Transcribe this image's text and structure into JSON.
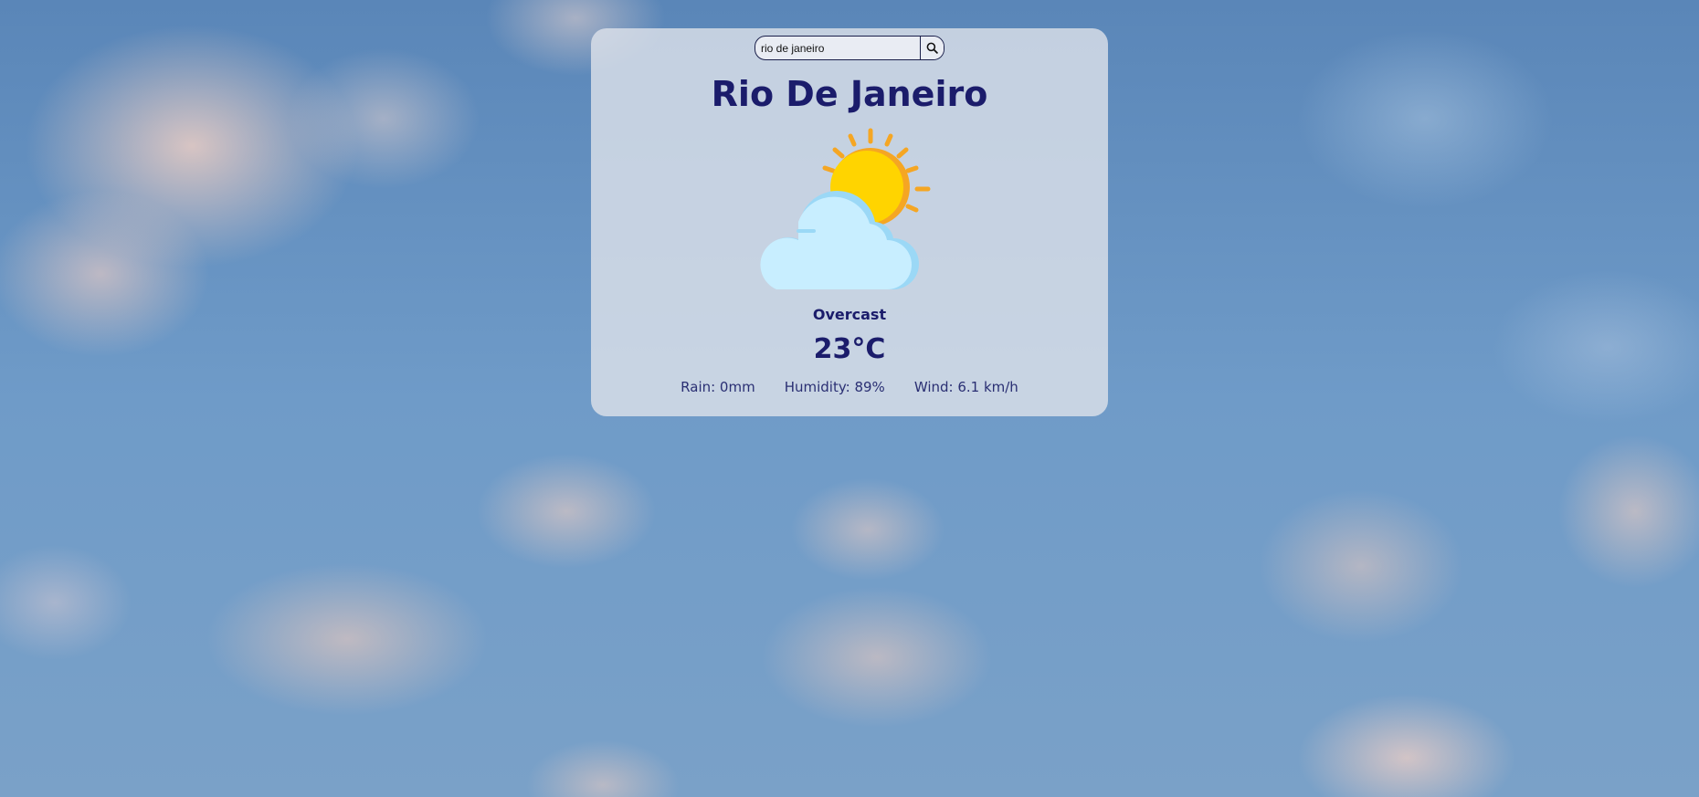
{
  "search": {
    "value": "rio de janeiro",
    "icon": "search-icon"
  },
  "weather": {
    "city": "Rio De Janeiro",
    "icon": "partly-cloudy-icon",
    "condition": "Overcast",
    "temperature": "23°C",
    "stats": {
      "rain": "Rain: 0mm",
      "humidity": "Humidity: 89%",
      "wind": "Wind: 6.1 km/h"
    }
  },
  "colors": {
    "text_primary": "#1b1c6b",
    "card_background": "rgba(220,225,233,0.82)",
    "sun": "#ffd400",
    "sun_rays": "#f5a623",
    "cloud": "#c8eeff"
  }
}
